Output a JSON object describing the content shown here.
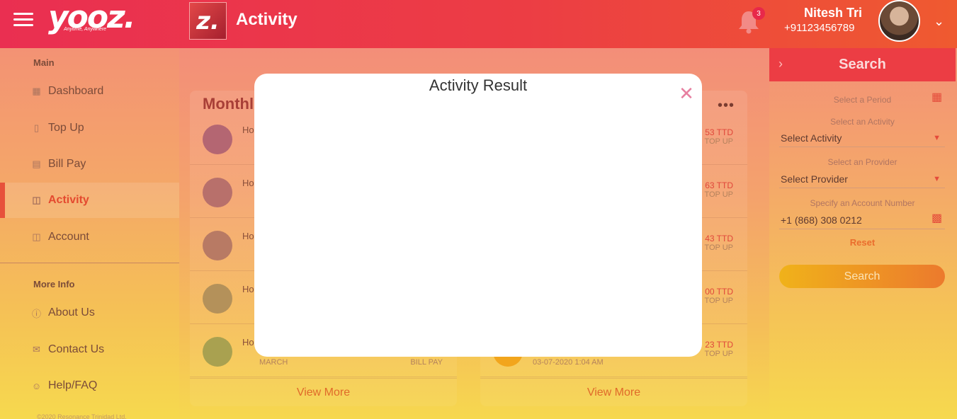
{
  "header": {
    "logo_text": "yooz.",
    "logo_tagline": "Anytime, Anywhere",
    "app_icon_letter": "z.",
    "page_title": "Activity",
    "notification_count": "3",
    "user_name": "Nitesh Tri",
    "user_phone": "+91123456789"
  },
  "sidebar": {
    "main_heading": "Main",
    "items": [
      {
        "label": "Dashboard"
      },
      {
        "label": "Top Up"
      },
      {
        "label": "Bill Pay"
      },
      {
        "label": "Activity"
      },
      {
        "label": "Account"
      }
    ],
    "more_heading": "More Info",
    "more_items": [
      {
        "label": "About Us"
      },
      {
        "label": "Contact Us"
      },
      {
        "label": "Help/FAQ"
      }
    ],
    "copyright": "©2020 Resonance Trinidad Ltd."
  },
  "main": {
    "left_card": {
      "title_partial": "Monthl",
      "rows": [
        {
          "label": "Ho",
          "sub": "",
          "type": ""
        },
        {
          "label": "Ho",
          "sub": "",
          "type": ""
        },
        {
          "label": "Ho",
          "sub": "",
          "type": ""
        },
        {
          "label": "Ho",
          "sub": "",
          "type": ""
        },
        {
          "label": "Ho",
          "sub": "MARCH",
          "type": "BILL PAY"
        }
      ],
      "view_more": "View More"
    },
    "right_card": {
      "rows": [
        {
          "amount": "53",
          "currency": "TTD",
          "type": "TOP UP",
          "date": ""
        },
        {
          "amount": "63",
          "currency": "TTD",
          "type": "TOP UP",
          "date": ""
        },
        {
          "amount": "43",
          "currency": "TTD",
          "type": "TOP UP",
          "date": ""
        },
        {
          "amount": "00",
          "currency": "TTD",
          "type": "TOP UP",
          "date": ""
        },
        {
          "amount": "23",
          "currency": "TTD",
          "type": "TOP UP",
          "date": "03-07-2020 1:04 AM"
        }
      ],
      "view_more": "View More"
    }
  },
  "search_panel": {
    "title": "Search",
    "period_label": "Select a Period",
    "activity_label": "Select an Activity",
    "activity_value": "Select Activity",
    "provider_label": "Select an Provider",
    "provider_value": "Select Provider",
    "account_label": "Specify an Account Number",
    "account_value": "+1 (868) 308 0212",
    "reset_label": "Reset",
    "search_button": "Search"
  },
  "modal": {
    "title": "Activity Result"
  },
  "colors": {
    "brand_red": "#ec3d44",
    "brand_orange": "#ef5a30",
    "brand_yellow": "#f6d94e"
  }
}
